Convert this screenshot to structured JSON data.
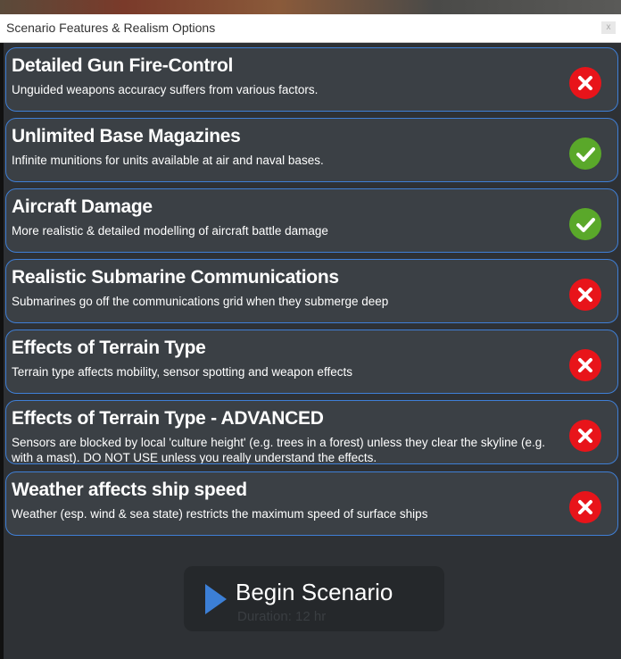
{
  "window": {
    "title": "Scenario Features & Realism Options",
    "close_glyph": "x"
  },
  "features": [
    {
      "title": "Detailed Gun Fire-Control",
      "description": "Unguided weapons accuracy suffers from various factors.",
      "enabled": false,
      "icon": "x-icon"
    },
    {
      "title": "Unlimited Base Magazines",
      "description": "Infinite munitions for units available at air and naval bases.",
      "enabled": true,
      "icon": "check-icon"
    },
    {
      "title": "Aircraft Damage",
      "description": "More realistic & detailed modelling of aircraft battle damage",
      "enabled": true,
      "icon": "check-icon"
    },
    {
      "title": "Realistic Submarine Communications",
      "description": "Submarines go off the communications grid when they submerge deep",
      "enabled": false,
      "icon": "x-icon"
    },
    {
      "title": "Effects of Terrain Type",
      "description": "Terrain type affects mobility, sensor spotting and weapon effects",
      "enabled": false,
      "icon": "x-icon"
    },
    {
      "title": "Effects of Terrain Type - ADVANCED",
      "description": "Sensors are blocked by local 'culture height' (e.g. trees in a forest) unless they clear the skyline (e.g. with a mast). DO NOT USE unless you really understand the effects.",
      "enabled": false,
      "icon": "x-icon"
    },
    {
      "title": "Weather affects ship speed",
      "description": "Weather (esp. wind & sea state) restricts the maximum speed of surface ships",
      "enabled": false,
      "icon": "x-icon"
    }
  ],
  "begin": {
    "label": "Begin Scenario",
    "duration": "Duration: 12 hr",
    "icon": "play-icon"
  },
  "colors": {
    "enabled": "#5aa82a",
    "disabled": "#e8141a",
    "accent": "#3f7fd6"
  }
}
